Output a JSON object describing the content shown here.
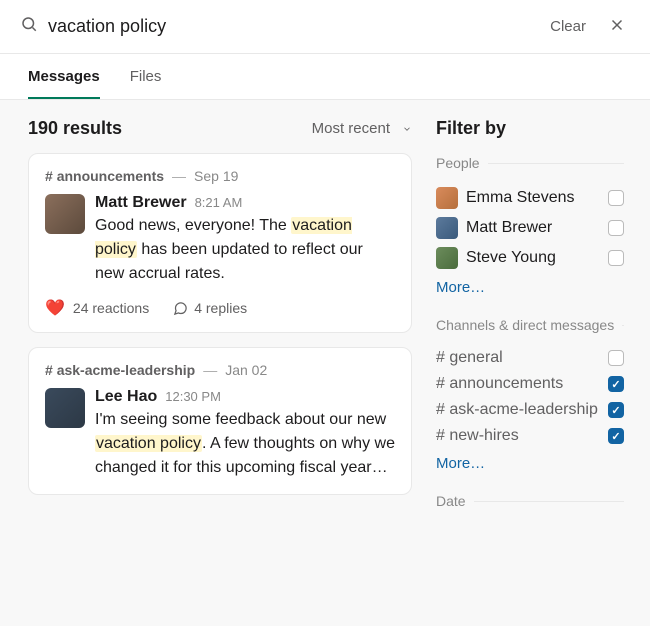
{
  "search": {
    "query": "vacation policy",
    "clear_label": "Clear"
  },
  "tabs": {
    "messages": "Messages",
    "files": "Files"
  },
  "results": {
    "count_label": "190 results",
    "sort_label": "Most recent"
  },
  "messages": [
    {
      "channel": "announcements",
      "date": "Sep 19",
      "user": "Matt Brewer",
      "time": "8:21 AM",
      "text_pre": "Good news, everyone! The ",
      "text_hl": "vacation policy",
      "text_post": " has been updated to reflect our new accrual rates.",
      "reactions_label": "24 reactions",
      "replies_label": "4 replies"
    },
    {
      "channel": "ask-acme-leadership",
      "date": "Jan 02",
      "user": "Lee Hao",
      "time": "12:30 PM",
      "text_pre": "I'm seeing some feedback about our new ",
      "text_hl": "vacation policy",
      "text_post": ". A few thoughts on why we changed it for this upcoming fiscal year…"
    }
  ],
  "filter": {
    "title": "Filter by",
    "people_label": "People",
    "people": [
      {
        "name": "Emma Stevens",
        "checked": false
      },
      {
        "name": "Matt Brewer",
        "checked": false
      },
      {
        "name": "Steve Young",
        "checked": false
      }
    ],
    "channels_label": "Channels & direct messages",
    "channels": [
      {
        "name": "general",
        "checked": false
      },
      {
        "name": "announcements",
        "checked": true
      },
      {
        "name": "ask-acme-leadership",
        "checked": true
      },
      {
        "name": "new-hires",
        "checked": true
      }
    ],
    "more_label": "More…",
    "date_label": "Date"
  }
}
